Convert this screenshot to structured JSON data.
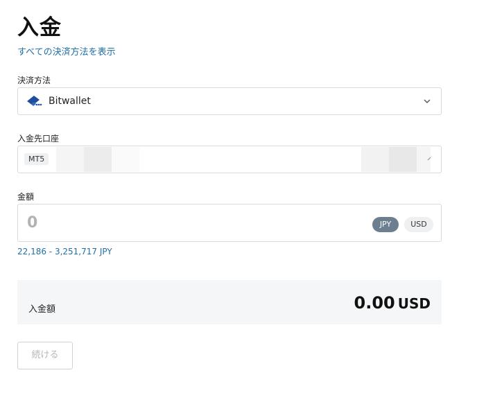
{
  "page": {
    "title": "入金",
    "all_methods_link": "すべての決済方法を表示"
  },
  "payment_method": {
    "label": "決済方法",
    "selected": "Bitwallet",
    "icon": "bitwallet-logo"
  },
  "deposit_account": {
    "label": "入金先口座",
    "platform": "MT5"
  },
  "amount": {
    "label": "金額",
    "placeholder": "0",
    "currencies": [
      "JPY",
      "USD"
    ],
    "active_currency": "JPY",
    "range": "22,186 - 3,251,717 JPY"
  },
  "summary": {
    "label": "入金額",
    "value": "0.00",
    "currency": "USD"
  },
  "actions": {
    "continue_label": "続ける"
  },
  "colors": {
    "link": "#1f6fa8",
    "active_chip": "#6b7f90",
    "summary_bg": "#f5f6f7",
    "bitwallet_blue": "#1d4f9c"
  }
}
